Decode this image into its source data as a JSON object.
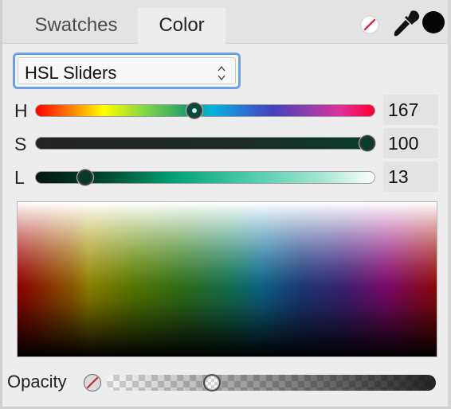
{
  "tabs": [
    {
      "label": "Swatches",
      "active": false
    },
    {
      "label": "Color",
      "active": true
    }
  ],
  "toolbar": {
    "icons": [
      "no-color-icon",
      "eyedropper-icon",
      "current-color-swatch"
    ],
    "current_color": "#050505"
  },
  "mode_select": {
    "value": "HSL Sliders"
  },
  "sliders": [
    {
      "key": "H",
      "label": "H",
      "value": "167",
      "fraction": 0.467
    },
    {
      "key": "S",
      "label": "S",
      "value": "100",
      "fraction": 1.0
    },
    {
      "key": "L",
      "label": "L",
      "value": "13",
      "fraction": 0.13
    }
  ],
  "opacity": {
    "label": "Opacity",
    "fraction": 0.31
  },
  "colors": {
    "focus_ring": "#6aa0e8",
    "knob_fill": "#0b4a3a",
    "panel_bg": "#ededed"
  }
}
